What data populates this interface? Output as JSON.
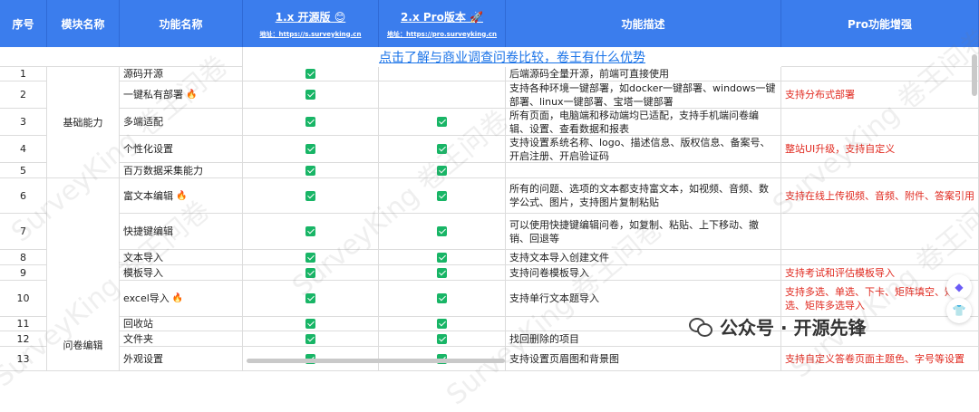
{
  "headers": {
    "index": "序号",
    "module": "模块名称",
    "feature": "功能名称",
    "v1_title": "1.x 开源版 😊",
    "v1_url": "地址：https://s.surveyking.cn",
    "v2_title": "2.x Pro版本 🚀",
    "v2_url": "地址：https://pro.surveyking.cn",
    "desc": "功能描述",
    "pro": "Pro功能增强"
  },
  "banner": "点击了解与商业调查问卷比较，卷王有什么优势",
  "groups": {
    "basic": "基础能力",
    "survey_edit": "问卷编辑"
  },
  "rows": [
    {
      "no": "1",
      "feature": "源码开源",
      "fire": false,
      "v1": true,
      "v2": false,
      "desc": "后端源码全量开源，前端可直接使用",
      "pro": ""
    },
    {
      "no": "2",
      "feature": "一键私有部署",
      "fire": true,
      "v1": true,
      "v2": false,
      "desc": "支持各种环境一键部署，如docker一键部署、windows一键部署、linux一键部署、宝塔一键部署",
      "pro": "支持分布式部署"
    },
    {
      "no": "3",
      "feature": "多端适配",
      "fire": false,
      "v1": true,
      "v2": true,
      "desc": "所有页面，电脑端和移动端均已适配，支持手机端问卷编辑、设置、查看数据和报表",
      "pro": ""
    },
    {
      "no": "4",
      "feature": "个性化设置",
      "fire": false,
      "v1": true,
      "v2": true,
      "desc": "支持设置系统名称、logo、描述信息、版权信息、备案号、开启注册、开启验证码",
      "pro": "整站UI升级，支持自定义"
    },
    {
      "no": "5",
      "feature": "百万数据采集能力",
      "fire": false,
      "v1": true,
      "v2": true,
      "desc": "",
      "pro": ""
    },
    {
      "no": "6",
      "feature": "富文本编辑",
      "fire": true,
      "v1": true,
      "v2": true,
      "desc": "所有的问题、选项的文本都支持富文本，如视频、音频、数学公式、图片，支持图片复制粘贴",
      "pro": "支持在线上传视频、音频、附件、答案引用"
    },
    {
      "no": "7",
      "feature": "快捷键编辑",
      "fire": false,
      "v1": true,
      "v2": true,
      "desc": "可以使用快捷键编辑问卷，如复制、粘贴、上下移动、撤销、回退等",
      "pro": ""
    },
    {
      "no": "8",
      "feature": "文本导入",
      "fire": false,
      "v1": true,
      "v2": true,
      "desc": "支持文本导入创建文件",
      "pro": ""
    },
    {
      "no": "9",
      "feature": "模板导入",
      "fire": false,
      "v1": true,
      "v2": true,
      "desc": "支持问卷模板导入",
      "pro": "支持考试和评估模板导入"
    },
    {
      "no": "10",
      "feature": "excel导入",
      "fire": true,
      "v1": true,
      "v2": true,
      "desc": "支持单行文本题导入",
      "pro": "支持多选、单选、下卡、矩阵填空、矩阵选、矩阵多选导入"
    },
    {
      "no": "11",
      "feature": "回收站",
      "fire": false,
      "v1": true,
      "v2": true,
      "desc": "",
      "pro": ""
    },
    {
      "no": "12",
      "feature": "文件夹",
      "fire": false,
      "v1": true,
      "v2": true,
      "desc": "找回删除的项目",
      "pro": ""
    },
    {
      "no": "13",
      "feature": "外观设置",
      "fire": false,
      "v1": true,
      "v2": true,
      "desc": "支持设置页眉图和背景图",
      "pro": "支持自定义答卷页面主题色、字号等设置"
    }
  ],
  "watermark": "SurveyKing 卷王问卷",
  "wechat": "公众号 · 开源先锋",
  "colors": {
    "header_bg": "#3b7ded",
    "check": "#18b566",
    "pro_text": "#e0291f",
    "link": "#1a73e8"
  }
}
